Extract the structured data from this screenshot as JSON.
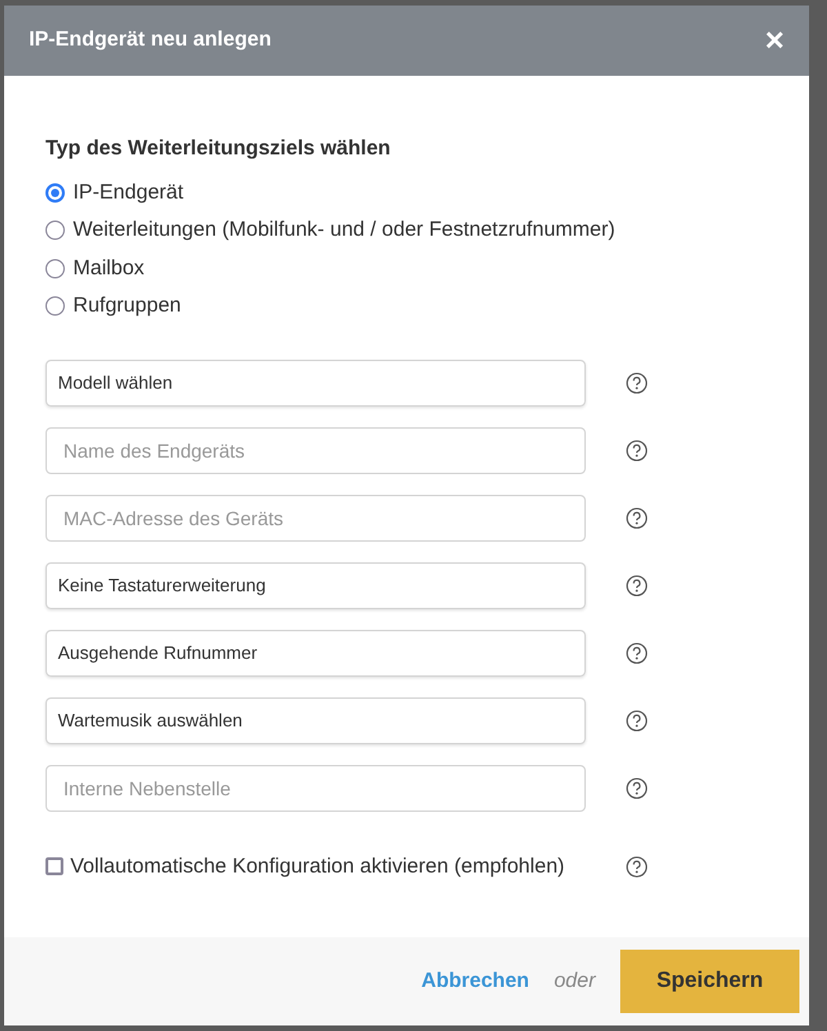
{
  "dialog": {
    "title": "IP-Endgerät neu anlegen",
    "close": "×"
  },
  "target_type": {
    "heading": "Typ des Weiterleitungsziels wählen",
    "options": [
      {
        "label": "IP-Endgerät",
        "selected": true
      },
      {
        "label": "Weiterleitungen (Mobilfunk- und / oder Festnetzrufnummer)",
        "selected": false
      },
      {
        "label": "Mailbox",
        "selected": false
      },
      {
        "label": "Rufgruppen",
        "selected": false
      }
    ]
  },
  "fields": [
    {
      "kind": "select",
      "value": "Modell wählen"
    },
    {
      "kind": "input",
      "placeholder": "Name des Endgeräts"
    },
    {
      "kind": "input",
      "placeholder": "MAC-Adresse des Geräts"
    },
    {
      "kind": "select",
      "value": "Keine Tastaturerweiterung"
    },
    {
      "kind": "select",
      "value": "Ausgehende Rufnummer"
    },
    {
      "kind": "select",
      "value": "Wartemusik auswählen"
    },
    {
      "kind": "input",
      "placeholder": "Interne Nebenstelle"
    }
  ],
  "auto_config": {
    "label": "Vollautomatische Konfiguration aktivieren (empfohlen)",
    "checked": false
  },
  "footer": {
    "cancel": "Abbrechen",
    "or": "oder",
    "save": "Speichern"
  }
}
